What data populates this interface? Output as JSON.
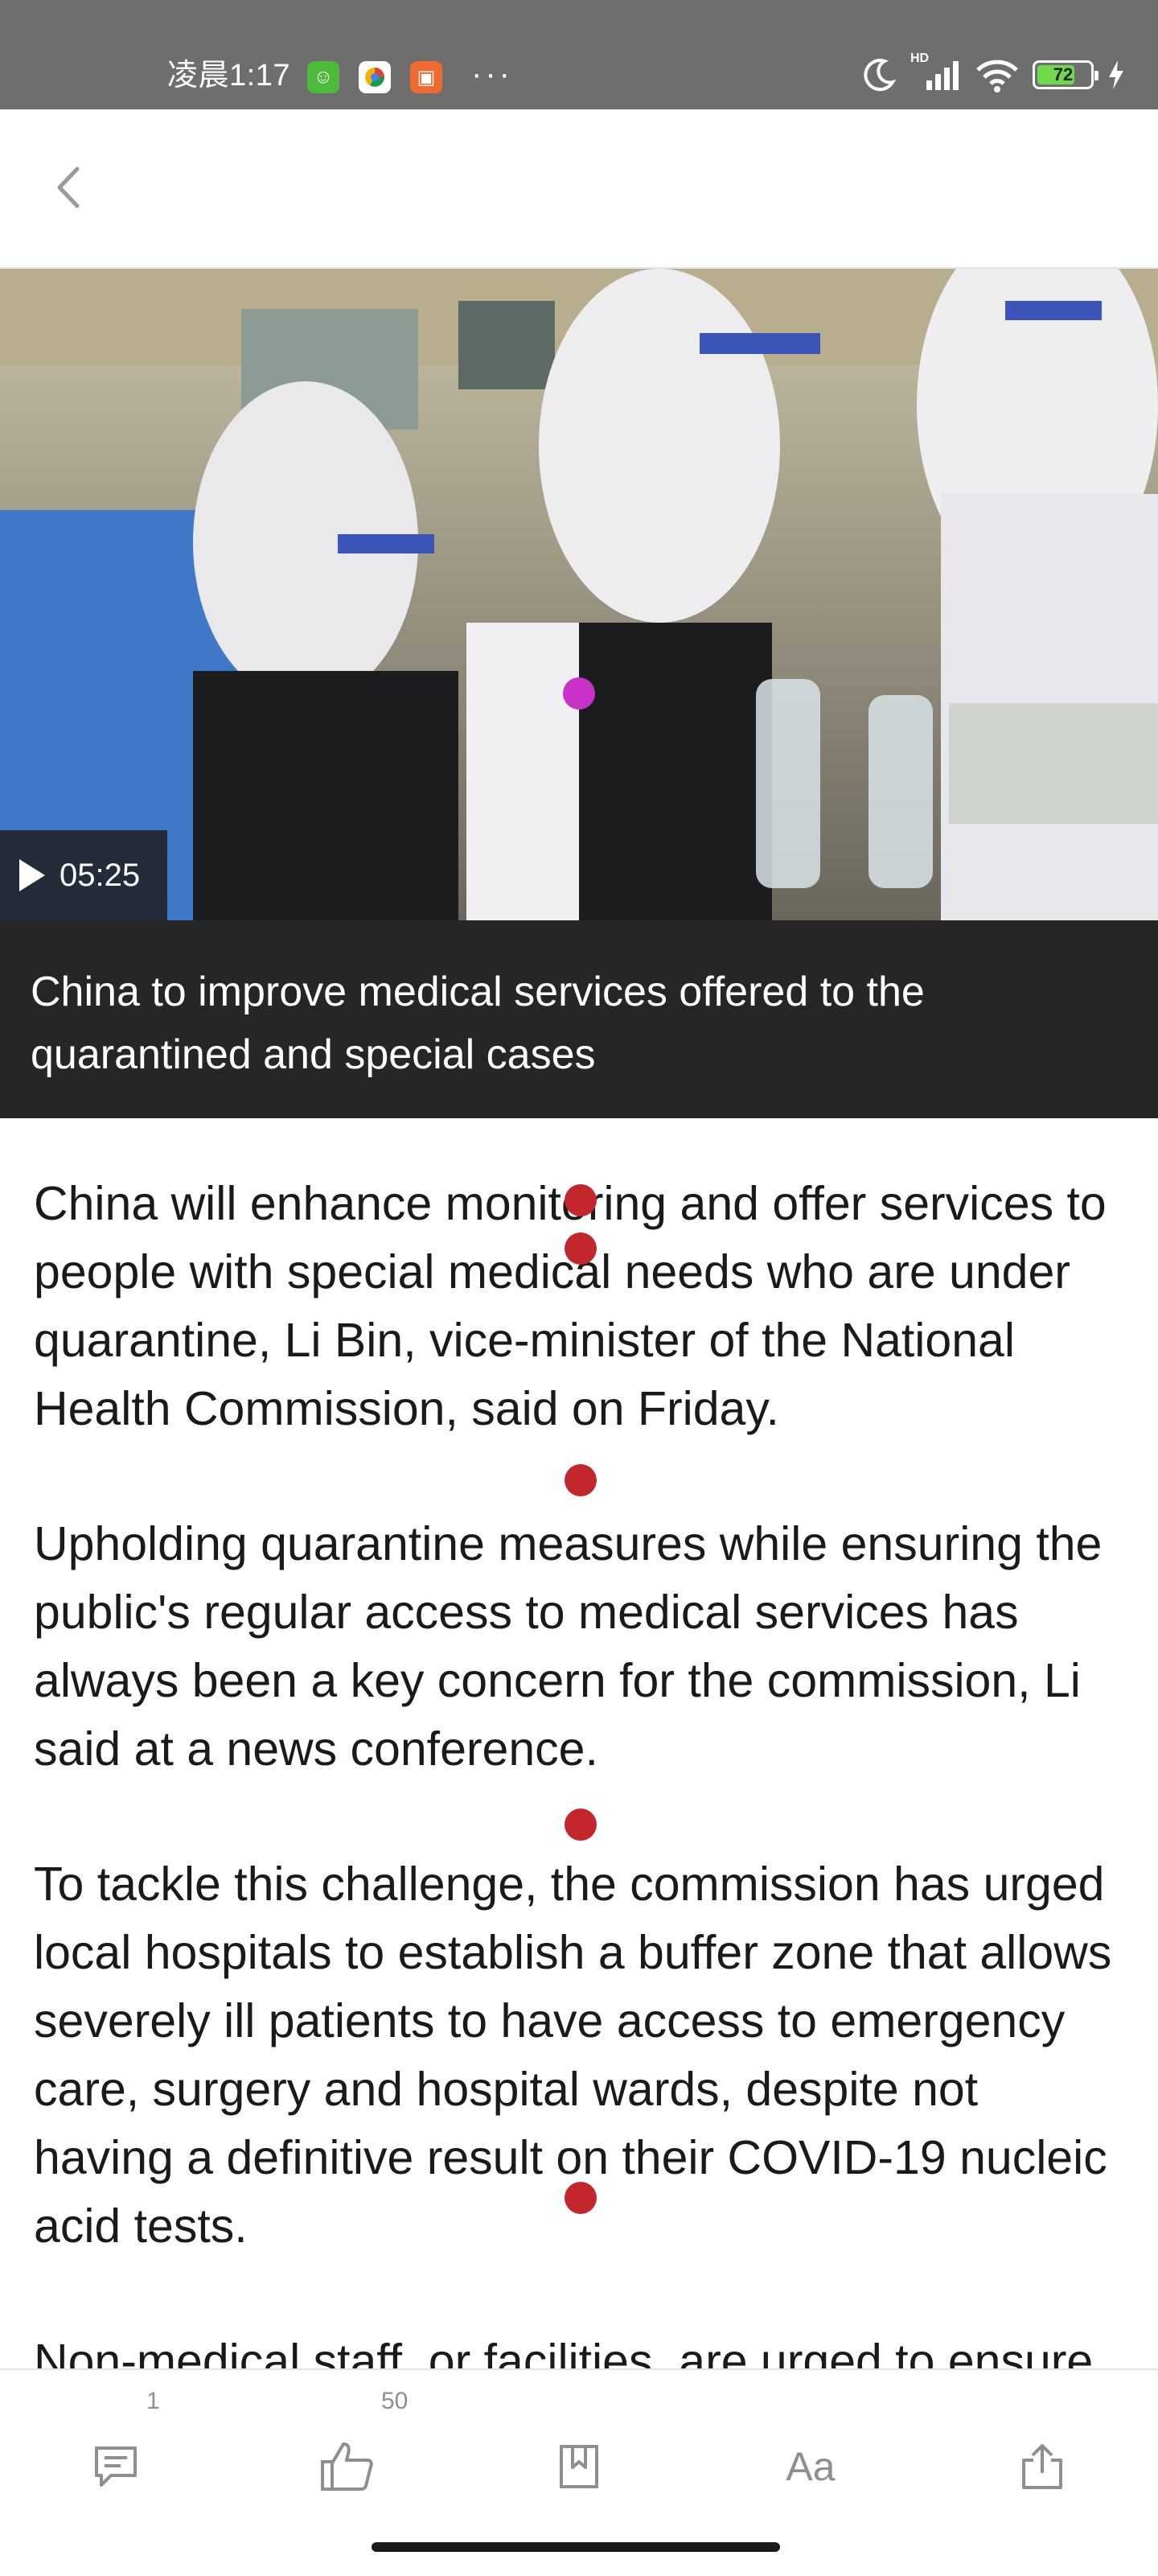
{
  "status_bar": {
    "time": "凌晨1:17",
    "more": "···",
    "network": "HD",
    "battery": "72",
    "battery_level": 0.72
  },
  "video": {
    "duration": "05:25",
    "caption": "China to improve medical services offered to the quarantined and special cases"
  },
  "article": {
    "paragraphs": [
      "China will enhance monitoring and offer services to people with special medical needs who are under quarantine, Li Bin, vice-minister of the National Health Commission, said on Friday.",
      "Upholding quarantine measures while ensuring the public's regular access to medical services has always been a key concern for the commission, Li said at a news conference.",
      "To tackle this challenge, the commission has urged local hospitals to establish a buffer zone that allows severely ill patients to have access to emergency care, surgery and hospital wards, despite not having a definitive result on their COVID-19 nucleic acid tests.",
      "Non-medical staff, or facilities, are urged to ensure"
    ]
  },
  "toolbar": {
    "comments_count": "1",
    "likes_count": "50",
    "font_label": "Aa"
  },
  "icons": {
    "back": "chevron-left-icon",
    "play": "play-icon",
    "comment": "comment-icon",
    "like": "thumbs-up-icon",
    "bookmark": "bookmark-icon",
    "font": "font-size-icon",
    "share": "share-icon"
  },
  "colors": {
    "status_bar": "#6e6e6e",
    "caption_bg": "#262626",
    "marker_red": "#c4262d",
    "marker_magenta": "#c832c8",
    "battery_green": "#6fd84b"
  }
}
